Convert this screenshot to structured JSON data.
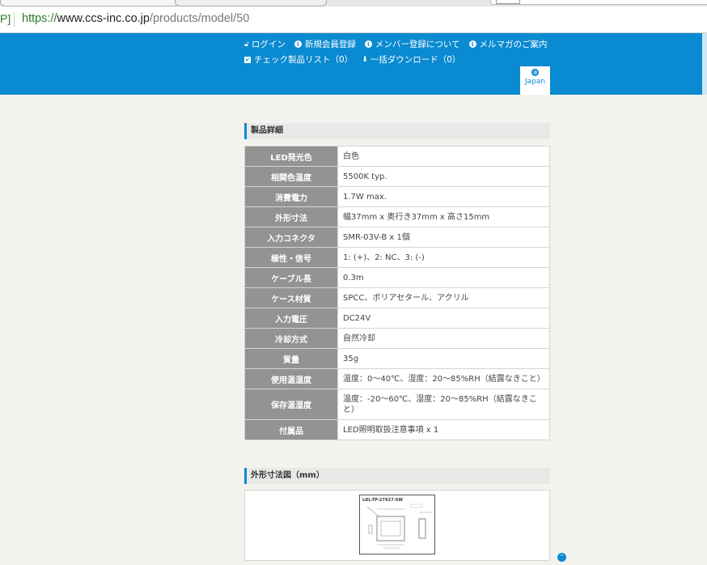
{
  "browser": {
    "prefix": "P]",
    "url_scheme": "https://",
    "url_host": "www.ccs-inc.co.jp",
    "url_path": "/products/model/50"
  },
  "header": {
    "links_row1": [
      {
        "icon": "lock-icon",
        "label": "ログイン"
      },
      {
        "icon": "info-icon",
        "label": "新規会員登録"
      },
      {
        "icon": "info-icon",
        "label": "メンバー登録について"
      },
      {
        "icon": "info-icon",
        "label": "メルマガのご案内"
      }
    ],
    "links_row2": [
      {
        "icon": "checkbox-icon",
        "label": "チェック製品リスト（0）"
      },
      {
        "icon": "download-icon",
        "label": "一括ダウンロード（0）"
      }
    ],
    "language": "Japan",
    "brand_color": "#0a8ad1"
  },
  "product_details": {
    "title": "製品詳細",
    "rows": [
      {
        "label": "LED発光色",
        "value": "白色"
      },
      {
        "label": "相関色温度",
        "value": "5500K typ."
      },
      {
        "label": "消費電力",
        "value": "1.7W max."
      },
      {
        "label": "外形寸法",
        "value": "幅37mm x 奥行き37mm x 高さ15mm"
      },
      {
        "label": "入力コネクタ",
        "value": "SMR-03V-B x 1個"
      },
      {
        "label": "極性・信号",
        "value": "1: (+)、2: NC、3: (-)"
      },
      {
        "label": "ケーブル長",
        "value": "0.3m"
      },
      {
        "label": "ケース材質",
        "value": "SPCC、ポリアセタール、アクリル"
      },
      {
        "label": "入力電圧",
        "value": "DC24V"
      },
      {
        "label": "冷却方式",
        "value": "自然冷却"
      },
      {
        "label": "質量",
        "value": "35g"
      },
      {
        "label": "使用温湿度",
        "value": "温度：0～40℃、湿度：20～85%RH（結露なきこと）"
      },
      {
        "label": "保存温湿度",
        "value": "温度：-20～60℃、湿度：20～85%RH（結露なきこと）"
      },
      {
        "label": "付属品",
        "value": "LED照明取扱注意事項 x 1"
      }
    ]
  },
  "dimension_drawing": {
    "title": "外形寸法図（mm）",
    "model_label": "LDL-TP-27X27-SW"
  }
}
